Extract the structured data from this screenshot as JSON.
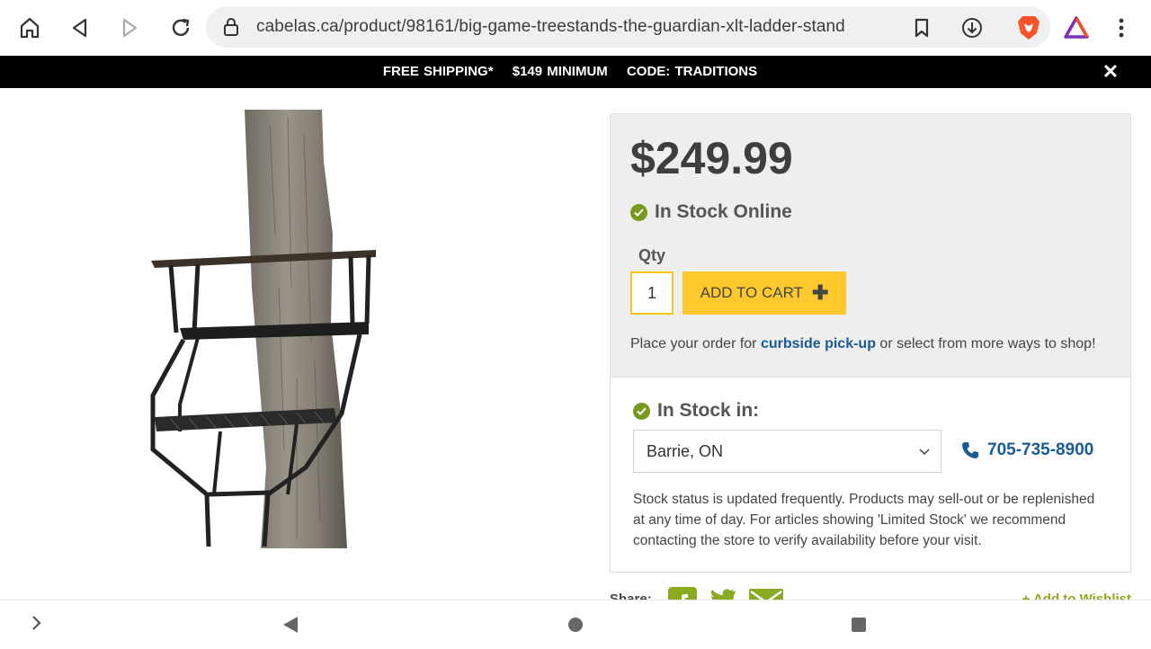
{
  "browser": {
    "url": "cabelas.ca/product/98161/big-game-treestands-the-guardian-xlt-ladder-stand",
    "icons": [
      "home-icon",
      "back-icon",
      "forward-icon",
      "reload-icon",
      "lock-icon",
      "bookmark-icon",
      "download-icon",
      "brave-icon",
      "rewards-icon",
      "menu-icon"
    ]
  },
  "promo": {
    "part1": "FREE SHIPPING*",
    "part2": "$149 MINIMUM",
    "part3": "CODE: TRADITIONS",
    "close": "✕"
  },
  "product": {
    "price": "$249.99",
    "stock_online": "In Stock Online",
    "qty_label": "Qty",
    "qty_value": "1",
    "add_to_cart": "ADD TO CART",
    "add_symbol": "✚",
    "pickup_prefix": "Place your order for ",
    "pickup_link": "curbside pick-up",
    "pickup_suffix": " or select from more ways to shop!"
  },
  "store": {
    "instock_label": "In Stock in:",
    "selected_store": "Barrie, ON",
    "phone": "705-735-8900",
    "note": "Stock status is updated frequently. Products may sell-out or be replenished at any time of day. For articles showing 'Limited Stock' we recommend contacting the store to verify availability before your visit."
  },
  "share": {
    "label": "Share:",
    "wishlist": "+ Add to Wishlist"
  },
  "colors": {
    "accent_yellow": "#ffc82c",
    "check_green": "#7a9a1e",
    "link_blue": "#1a5a96",
    "promo_bg": "#000000"
  }
}
